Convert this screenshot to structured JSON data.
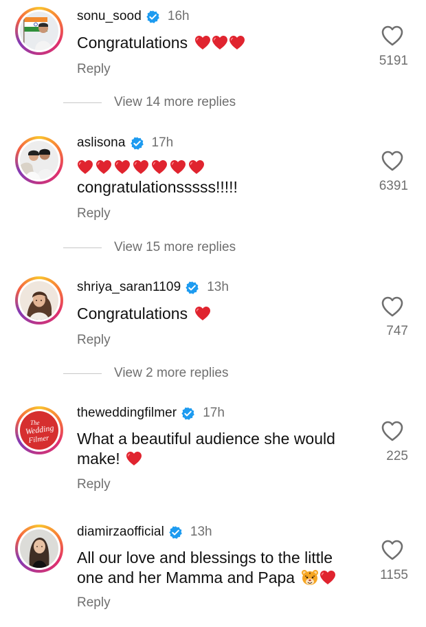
{
  "comments": [
    {
      "username": "sonu_sood",
      "time": "16h",
      "text": "Congratulations",
      "hearts": 3,
      "reply_label": "Reply",
      "likes": "5191",
      "view_replies": "View 14 more replies"
    },
    {
      "username": "aslisona",
      "time": "17h",
      "hearts_line": 7,
      "text": "congratulationsssss!!!!!",
      "reply_label": "Reply",
      "likes": "6391",
      "view_replies": "View 15 more replies"
    },
    {
      "username": "shriya_saran1109",
      "time": "13h",
      "text": "Congratulations",
      "hearts": 1,
      "reply_label": "Reply",
      "likes": "747",
      "view_replies": "View 2 more replies"
    },
    {
      "username": "theweddingfilmer",
      "time": "17h",
      "text_line1": "What a beautiful audience she would",
      "text_line2": "make!",
      "hearts": 1,
      "reply_label": "Reply",
      "likes": "225",
      "avatar_logo": [
        "The",
        "Wedding",
        "Filmer"
      ]
    },
    {
      "username": "diamirzaofficial",
      "time": "13h",
      "text_line1": "All our love and blessings to the little",
      "text_line2": "one and her Mamma and Papa",
      "reply_label": "Reply",
      "likes": "1155"
    }
  ],
  "colors": {
    "verified": "#1d9bf0",
    "heart": "#e0242f",
    "muted": "#6f6f6f",
    "logo_red": "#d62f2f"
  },
  "icons": {
    "like": "heart-outline-icon",
    "verified": "verified-badge-icon",
    "emoji_heart": "red-heart-emoji",
    "emoji_tiger": "tiger-face-emoji"
  }
}
